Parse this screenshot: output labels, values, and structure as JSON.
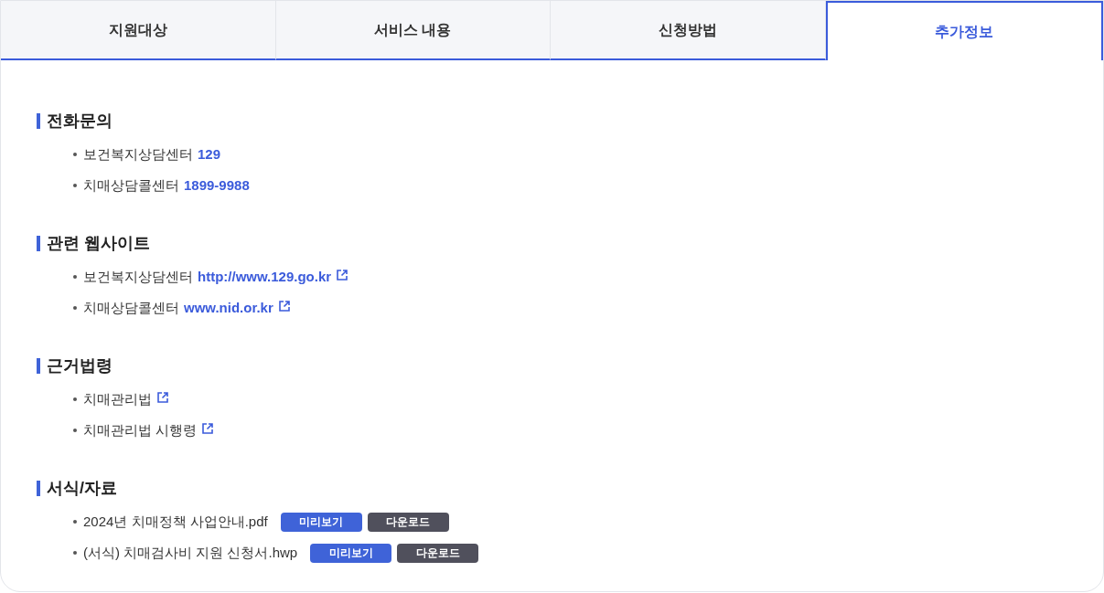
{
  "tabs": [
    {
      "label": "지원대상",
      "selected": false
    },
    {
      "label": "서비스 내용",
      "selected": false
    },
    {
      "label": "신청방법",
      "selected": false
    },
    {
      "label": "추가정보",
      "selected": true
    }
  ],
  "sections": [
    {
      "title": "전화문의",
      "items": [
        {
          "kind": "phone",
          "label": "보건복지상담센터",
          "value": "129"
        },
        {
          "kind": "phone",
          "label": "치매상담콜센터",
          "value": "1899-9988"
        }
      ]
    },
    {
      "title": "관련 웹사이트",
      "items": [
        {
          "kind": "website",
          "label": "보건복지상담센터",
          "value": "http://www.129.go.kr"
        },
        {
          "kind": "website",
          "label": "치매상담콜센터",
          "value": "www.nid.or.kr"
        }
      ]
    },
    {
      "title": "근거법령",
      "items": [
        {
          "kind": "law",
          "label": "치매관리법"
        },
        {
          "kind": "law",
          "label": "치매관리법 시행령"
        }
      ]
    },
    {
      "title": "서식/자료",
      "items": [
        {
          "kind": "file",
          "label": "2024년 치매정책 사업안내.pdf",
          "buttons": [
            {
              "kind": "preview",
              "label": "미리보기"
            },
            {
              "kind": "download",
              "label": "다운로드"
            }
          ]
        },
        {
          "kind": "file",
          "label": "(서식) 치매검사비 지원 신청서.hwp",
          "buttons": [
            {
              "kind": "preview",
              "label": "미리보기"
            },
            {
              "kind": "download",
              "label": "다운로드"
            }
          ]
        }
      ]
    }
  ]
}
